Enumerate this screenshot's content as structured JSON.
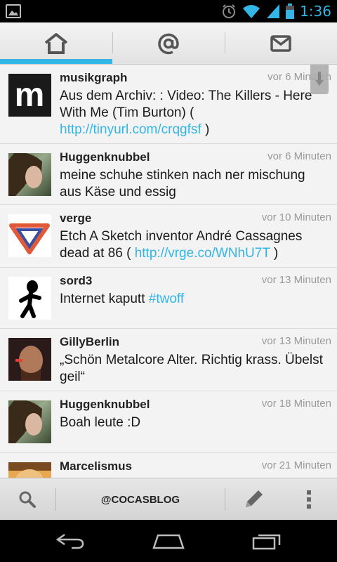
{
  "status_bar": {
    "time": "1:36",
    "icons": [
      "gallery-icon",
      "alarm-icon",
      "wifi-icon",
      "signal-icon",
      "battery-icon"
    ],
    "accent": "#33b5e5"
  },
  "tabs": [
    {
      "name": "home",
      "icon": "home-icon",
      "selected": true
    },
    {
      "name": "mentions",
      "icon": "at-icon",
      "selected": false
    },
    {
      "name": "messages",
      "icon": "envelope-icon",
      "selected": false
    }
  ],
  "tweets": [
    {
      "user": "musikgraph",
      "time": "vor 6 Minuten",
      "text": "Aus dem Archiv: : Video: The Killers - Here With Me (Tim Burton) ( ",
      "link": "http://tinyurl.com/crqgfsf",
      "after": " )"
    },
    {
      "user": "Huggenknubbel",
      "time": "vor 6 Minuten",
      "text": "meine schuhe stinken nach ner mischung aus Käse und essig",
      "link": "",
      "after": ""
    },
    {
      "user": "verge",
      "time": "vor 10 Minuten",
      "text": "Etch A Sketch inventor André Cassagnes dead at 86 ( ",
      "link": "http://vrge.co/WNhU7T",
      "after": " )"
    },
    {
      "user": "sord3",
      "time": "vor 13 Minuten",
      "text": "Internet kaputt ",
      "link": "#twoff",
      "after": ""
    },
    {
      "user": "GillyBerlin",
      "time": "vor 13 Minuten",
      "text": "„Schön Metalcore Alter. Richtig krass. Übelst geil“",
      "link": "",
      "after": ""
    },
    {
      "user": "Huggenknubbel",
      "time": "vor 18 Minuten",
      "text": "Boah leute :D",
      "link": "",
      "after": ""
    },
    {
      "user": "Marcelismus",
      "time": "vor 21 Minuten",
      "text": "",
      "link": "",
      "after": ""
    }
  ],
  "action_bar": {
    "search_icon": "search-icon",
    "account": "@COCASBLOG",
    "compose_icon": "pencil-icon",
    "overflow_icon": "overflow-menu-icon"
  },
  "nav_bar": {
    "icons": [
      "back-icon",
      "home-nav-icon",
      "recents-icon"
    ]
  },
  "colors": {
    "link": "#33b5e5",
    "background": "#f3f3f3"
  }
}
